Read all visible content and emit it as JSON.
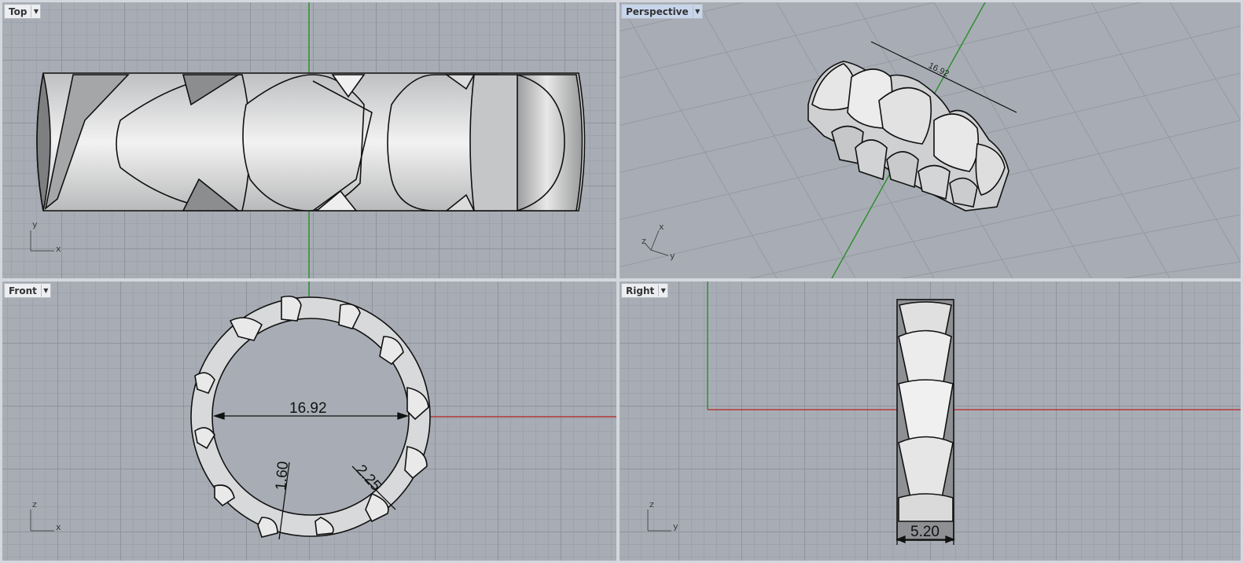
{
  "viewports": {
    "top": {
      "title": "Top",
      "axis_h": "x",
      "axis_v": "y"
    },
    "perspective": {
      "title": "Perspective",
      "axis_h": "x",
      "axis_v": "y",
      "axis_d": "z"
    },
    "front": {
      "title": "Front",
      "axis_h": "x",
      "axis_v": "z"
    },
    "right": {
      "title": "Right",
      "axis_h": "y",
      "axis_v": "z"
    }
  },
  "dimensions": {
    "inner_diameter": "16.92",
    "thickness": "1.60",
    "height": "2.25",
    "width": "5.20"
  },
  "dropdown_icon": "triangle-down-icon",
  "colors": {
    "x_axis": "#b23a3a",
    "y_axis": "#2f8f2f",
    "active_title": "#c8d6ec"
  }
}
